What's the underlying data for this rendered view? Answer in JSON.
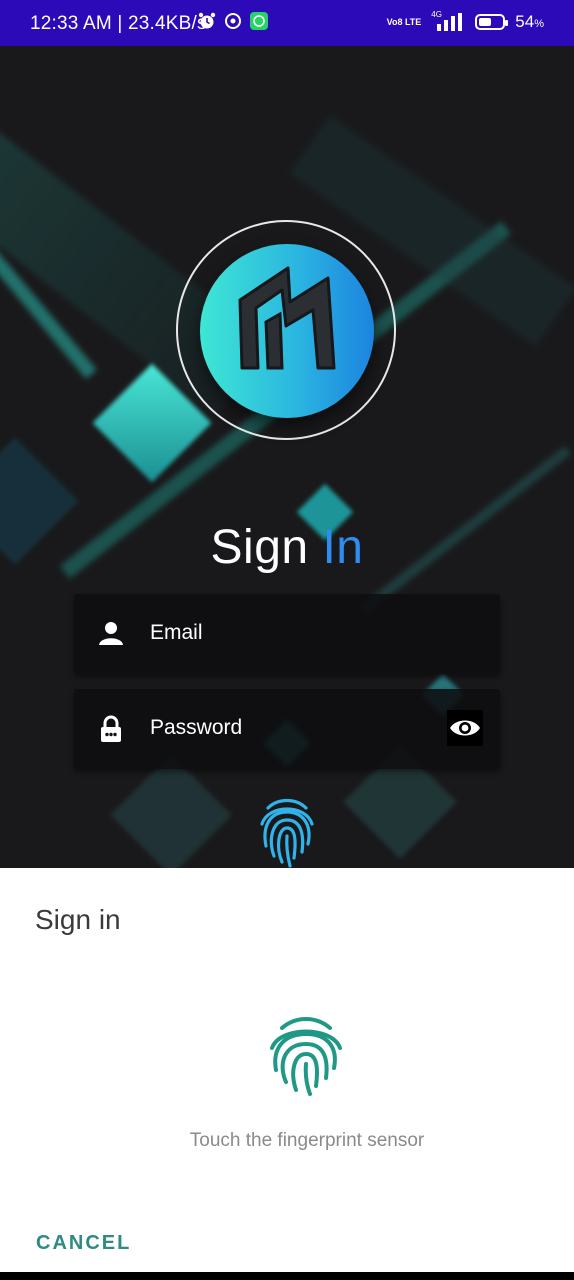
{
  "status_bar": {
    "time": "12:33 AM | 23.4KB/s",
    "network_type": "4G",
    "volte": "Vo8 LTE",
    "battery_percent": "54",
    "battery_symbol": "%",
    "battery_level": 0.54,
    "icons": [
      "alarm-icon",
      "data-saver-icon",
      "whatsapp-icon",
      "signal-icon",
      "battery-icon"
    ]
  },
  "login": {
    "title_part1": "Sign ",
    "title_part2": "In",
    "email_placeholder": "Email",
    "password_placeholder": "Password"
  },
  "dialog": {
    "title": "Sign in",
    "hint": "Touch the fingerprint sensor",
    "cancel_label": "CANCEL"
  },
  "colors": {
    "status_bar": "#2c0ab8",
    "accent_blue": "#2f8cf0",
    "teal": "#2f8b82",
    "logo_gradient_start": "#3ee7d4",
    "logo_gradient_end": "#1c84e0"
  }
}
